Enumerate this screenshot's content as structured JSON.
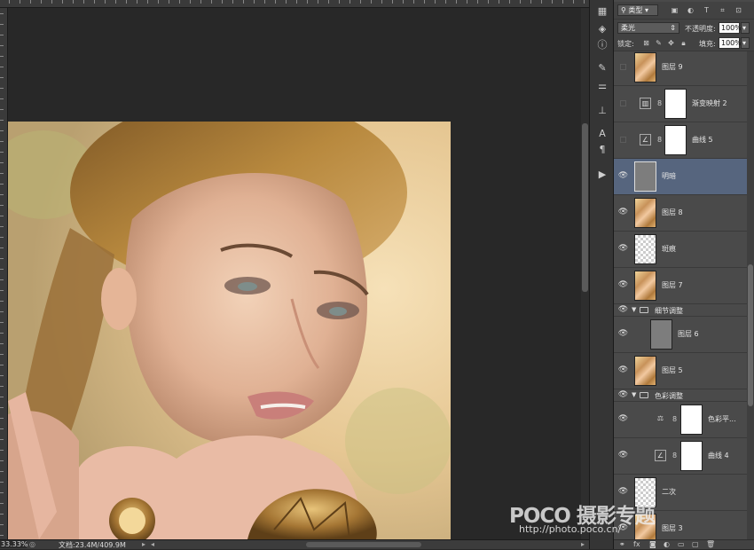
{
  "status_bar": {
    "zoom": "33.33%",
    "doc_info": "文档:23.4M/409.9M"
  },
  "layers_panel": {
    "filter_kind": "类型",
    "blend_mode": "柔光",
    "opacity_label": "不透明度:",
    "opacity_value": "100%",
    "lock_label": "锁定:",
    "fill_label": "填充:",
    "fill_value": "100%"
  },
  "layers": [
    {
      "name": "图层 9",
      "visible": false,
      "kind": "pixel",
      "thumb": "portrait"
    },
    {
      "name": "渐变映射 2",
      "visible": false,
      "kind": "adjustment",
      "icon": "gradient-map-icon"
    },
    {
      "name": "曲线 5",
      "visible": false,
      "kind": "adjustment",
      "icon": "curves-icon"
    },
    {
      "name": "明暗",
      "visible": true,
      "kind": "pixel",
      "thumb": "gray",
      "selected": true
    },
    {
      "name": "图层 8",
      "visible": true,
      "kind": "pixel",
      "thumb": "portrait"
    },
    {
      "name": "斑痕",
      "visible": true,
      "kind": "pixel",
      "thumb": "checker"
    },
    {
      "name": "图层 7",
      "visible": true,
      "kind": "pixel",
      "thumb": "portrait"
    },
    {
      "name": "细节调整",
      "visible": true,
      "kind": "group"
    },
    {
      "name": "图层 6",
      "visible": true,
      "kind": "pixel",
      "thumb": "gray",
      "indent": true
    },
    {
      "name": "图层 5",
      "visible": true,
      "kind": "pixel",
      "thumb": "portrait"
    },
    {
      "name": "色彩调整",
      "visible": true,
      "kind": "group"
    },
    {
      "name": "色彩平...",
      "visible": true,
      "kind": "adjustment",
      "icon": "color-balance-icon",
      "indent": true
    },
    {
      "name": "曲线 4",
      "visible": true,
      "kind": "adjustment",
      "icon": "curves-icon",
      "indent": true
    },
    {
      "name": "二次",
      "visible": true,
      "kind": "pixel",
      "thumb": "checker"
    },
    {
      "name": "图层 3",
      "visible": true,
      "kind": "pixel",
      "thumb": "portrait"
    }
  ],
  "watermark": {
    "brand": "POCO 摄影专题",
    "url": "http://photo.poco.cn/"
  },
  "colors": {
    "selection": "#56657e",
    "panel_bg": "#4a4a4a",
    "workspace": "#282828"
  }
}
